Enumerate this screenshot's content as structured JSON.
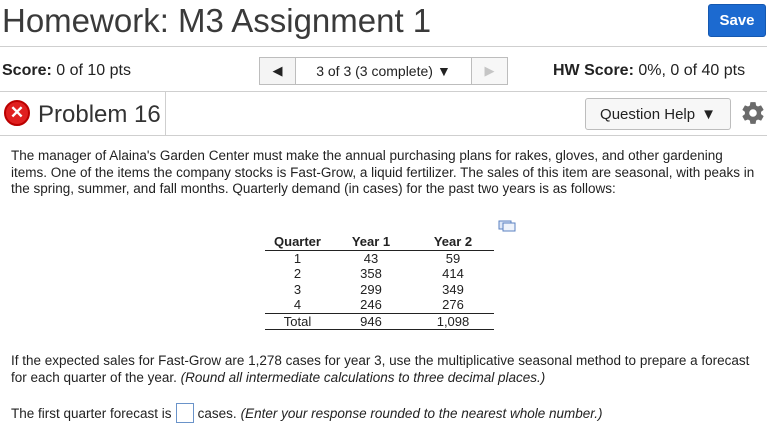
{
  "header": {
    "title": "Homework: M3 Assignment 1",
    "save_label": "Save"
  },
  "score_bar": {
    "score_label": "Score:",
    "score_value": "0 of 10 pts",
    "nav_prev_icon": "triangle-left-icon",
    "nav_select_value": "3 of 3 (3 complete)",
    "nav_next_icon": "triangle-right-icon",
    "hw_score_label": "HW Score:",
    "hw_score_value": "0%, 0 of 40 pts"
  },
  "problem_bar": {
    "status_icon": "x-circle-icon",
    "status_color": "#e02020",
    "title": "Problem 16",
    "help_label": "Question Help",
    "settings_icon": "gear-icon"
  },
  "problem": {
    "intro": "The manager of Alaina's Garden Center must make the annual purchasing plans for rakes, gloves, and other gardening items. One of the items the company stocks is Fast-Grow, a liquid fertilizer. The sales of this item are seasonal, with peaks in the spring, summer, and fall months. Quarterly demand (in cases) for the past two years is as follows:",
    "table": {
      "headers": [
        "Quarter",
        "Year 1",
        "Year 2"
      ],
      "rows": [
        [
          "1",
          "43",
          "59"
        ],
        [
          "2",
          "358",
          "414"
        ],
        [
          "3",
          "299",
          "349"
        ],
        [
          "4",
          "246",
          "276"
        ]
      ],
      "total": [
        "Total",
        "946",
        "1,098"
      ]
    },
    "instruction_main": "If the expected sales for Fast-Grow are 1,278 cases for year 3, use the multiplicative seasonal method to prepare a forecast for each quarter of the year. ",
    "instruction_note": "(Round all intermediate calculations to three decimal places.)",
    "answer_prefix": "The first quarter forecast is",
    "answer_value": "",
    "answer_suffix": "cases.",
    "answer_note": "(Enter your response rounded to the nearest whole number.)"
  }
}
